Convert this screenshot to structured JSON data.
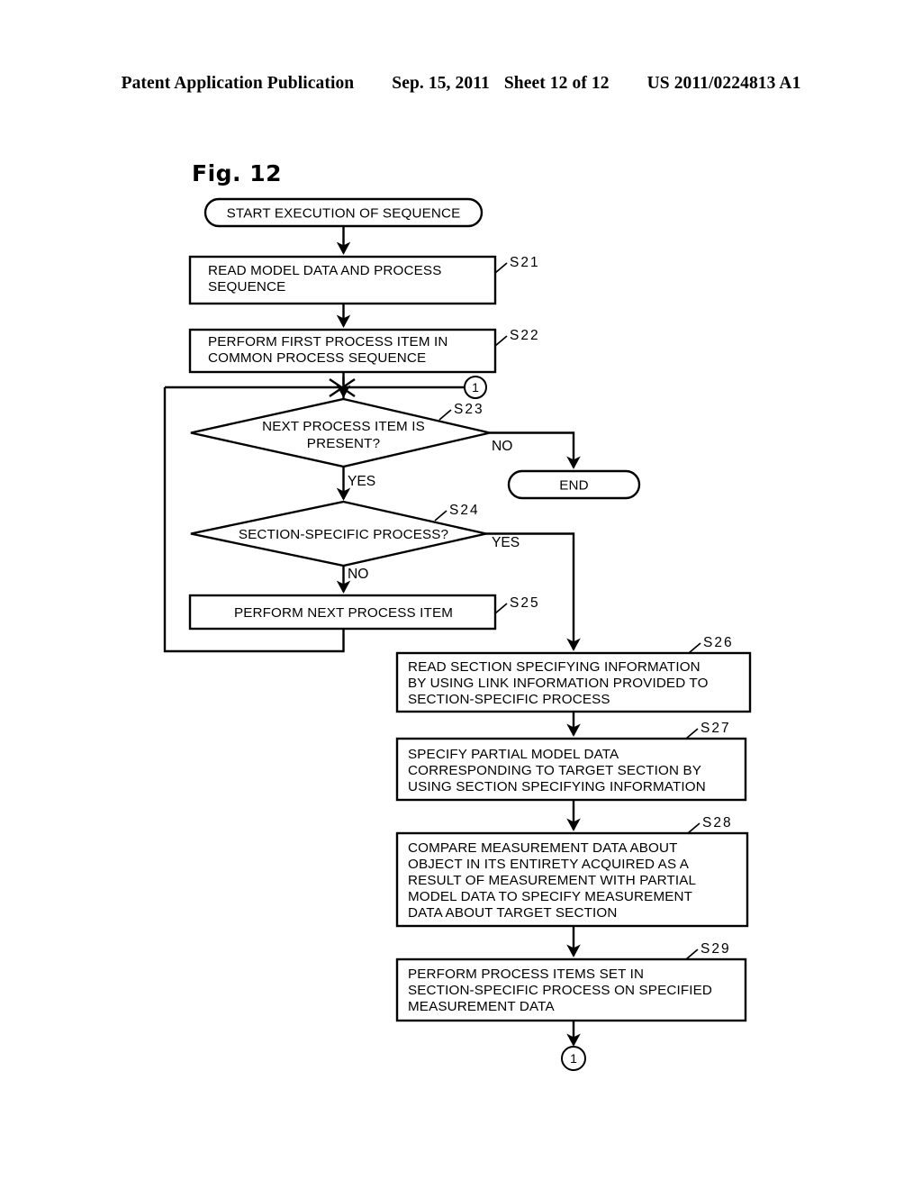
{
  "header": {
    "publication": "Patent Application Publication",
    "date": "Sep. 15, 2011",
    "sheet": "Sheet 12 of 12",
    "number": "US 2011/0224813 A1"
  },
  "figure": {
    "label": "Fig. 12"
  },
  "flowchart": {
    "start": {
      "text": "START EXECUTION OF SEQUENCE"
    },
    "end": {
      "text": "END"
    },
    "connector_top": {
      "text": "1"
    },
    "connector_bottom": {
      "text": "1"
    },
    "steps": [
      {
        "id": "S21",
        "step_label": "S21",
        "shape": "process",
        "lines": [
          "READ MODEL DATA AND PROCESS",
          "SEQUENCE"
        ]
      },
      {
        "id": "S22",
        "step_label": "S22",
        "shape": "process",
        "lines": [
          "PERFORM FIRST PROCESS ITEM IN",
          "COMMON PROCESS SEQUENCE"
        ]
      },
      {
        "id": "S23",
        "step_label": "S23",
        "shape": "decision",
        "lines": [
          "NEXT PROCESS ITEM IS",
          "PRESENT?"
        ],
        "yes_label": "YES",
        "no_label": "NO"
      },
      {
        "id": "S24",
        "step_label": "S24",
        "shape": "decision",
        "lines": [
          "SECTION-SPECIFIC PROCESS?"
        ],
        "yes_label": "YES",
        "no_label": "NO"
      },
      {
        "id": "S25",
        "step_label": "S25",
        "shape": "process",
        "lines": [
          "PERFORM NEXT PROCESS ITEM"
        ]
      },
      {
        "id": "S26",
        "step_label": "S26",
        "shape": "process",
        "lines": [
          "READ SECTION SPECIFYING INFORMATION",
          "BY USING LINK INFORMATION PROVIDED TO",
          "SECTION-SPECIFIC PROCESS"
        ]
      },
      {
        "id": "S27",
        "step_label": "S27",
        "shape": "process",
        "lines": [
          "SPECIFY PARTIAL MODEL DATA",
          "CORRESPONDING TO TARGET SECTION BY",
          "USING SECTION SPECIFYING INFORMATION"
        ]
      },
      {
        "id": "S28",
        "step_label": "S28",
        "shape": "process",
        "lines": [
          "COMPARE MEASUREMENT DATA ABOUT",
          "OBJECT IN ITS ENTIRETY ACQUIRED AS A",
          "RESULT OF MEASUREMENT WITH PARTIAL",
          "MODEL DATA TO SPECIFY MEASUREMENT",
          "DATA ABOUT TARGET SECTION"
        ]
      },
      {
        "id": "S29",
        "step_label": "S29",
        "shape": "process",
        "lines": [
          "PERFORM PROCESS ITEMS SET IN",
          "SECTION-SPECIFIC PROCESS ON SPECIFIED",
          "MEASUREMENT DATA"
        ]
      }
    ]
  }
}
